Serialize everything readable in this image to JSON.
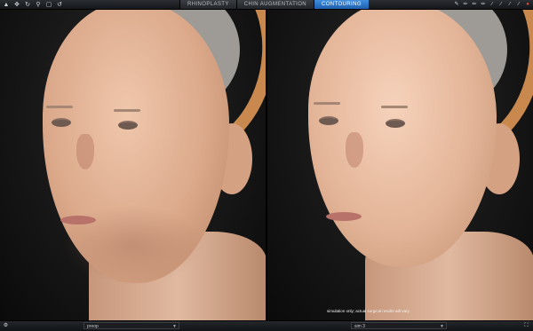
{
  "toolbar": {
    "left_icons": [
      "pointer-icon",
      "move-icon",
      "rotate-icon",
      "zoom-icon",
      "reset-icon",
      "undo-icon"
    ],
    "right_icons": [
      "brush-icon",
      "pen-icon",
      "pen2-icon",
      "pen3-icon",
      "line-icon",
      "line2-icon",
      "line3-icon",
      "line4-icon",
      "marker-icon"
    ]
  },
  "tabs": [
    {
      "label": "RHINOPLASTY",
      "active": false
    },
    {
      "label": "CHIN AUGMENTATION",
      "active": false
    },
    {
      "label": "CONTOURING",
      "active": true
    }
  ],
  "panels": {
    "left": {
      "select_value": "preop"
    },
    "right": {
      "select_value": "sim 3",
      "disclaimer": "simulation only; actual surgical results will vary"
    }
  },
  "colors": {
    "accent": "#2f7fd6",
    "headband": "#c9894e"
  }
}
